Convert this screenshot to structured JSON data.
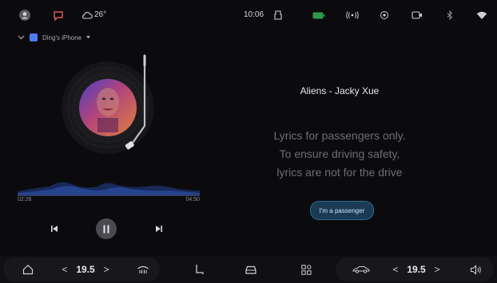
{
  "status_bar": {
    "weather": "26°",
    "time": "10:06",
    "icons": [
      "avatar-icon",
      "message-icon",
      "cloud-icon",
      "cabin-icon",
      "battery-icon",
      "signal-broadcast-icon",
      "location-icon",
      "camera-icon",
      "bluetooth-icon",
      "wifi-icon"
    ]
  },
  "music": {
    "device_name": "Ding's iPhone",
    "elapsed": "02:26",
    "duration": "04:50",
    "progress": 0.5
  },
  "lyrics": {
    "song": "Aliens - Jacky Xue",
    "lines": [
      "Lyrics for passengers only.",
      "To ensure driving safety,",
      "lyrics are not for the drive"
    ],
    "passenger_button": "I'm a passenger"
  },
  "bottom_bar": {
    "left_temp": "19.5",
    "right_temp": "19.5",
    "left_chev_l": "<",
    "left_chev_r": ">",
    "right_chev_l": "<",
    "right_chev_r": ">"
  },
  "colors": {
    "accent": "#4c7df0",
    "button_bg": "#1b3b55",
    "wave": "#2c4fa8"
  }
}
